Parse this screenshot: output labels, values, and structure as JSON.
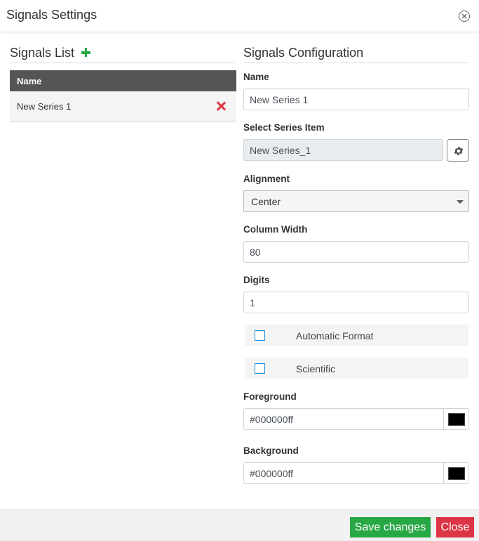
{
  "modal": {
    "title": "Signals Settings",
    "close_icon": "circle-x-icon"
  },
  "signals_list": {
    "title": "Signals List",
    "add_icon": "plus-icon",
    "columns": [
      "Name"
    ],
    "rows": [
      {
        "name": "New Series 1",
        "delete_icon": "x-icon"
      }
    ]
  },
  "config": {
    "title": "Signals Configuration",
    "name_label": "Name",
    "name_value": "New Series 1",
    "series_item_label": "Select Series Item",
    "series_item_value": "New Series_1",
    "series_item_button_icon": "gear-icon",
    "alignment_label": "Alignment",
    "alignment_value": "Center",
    "column_width_label": "Column Width",
    "column_width_value": "80",
    "digits_label": "Digits",
    "digits_value": "1",
    "automatic_format": {
      "label": "Automatic Format",
      "checked": false
    },
    "scientific": {
      "label": "Scientific",
      "checked": false
    },
    "foreground_label": "Foreground",
    "foreground_value": "#000000ff",
    "background_label": "Background",
    "background_value": "#000000ff"
  },
  "footer": {
    "save_label": "Save changes",
    "close_label": "Close"
  },
  "colors": {
    "save": "#28a745",
    "close": "#dc3545",
    "table_header": "#555555",
    "add": "#28a745",
    "delete": "#dc3545",
    "checkbox_border": "#1f8dd6"
  }
}
